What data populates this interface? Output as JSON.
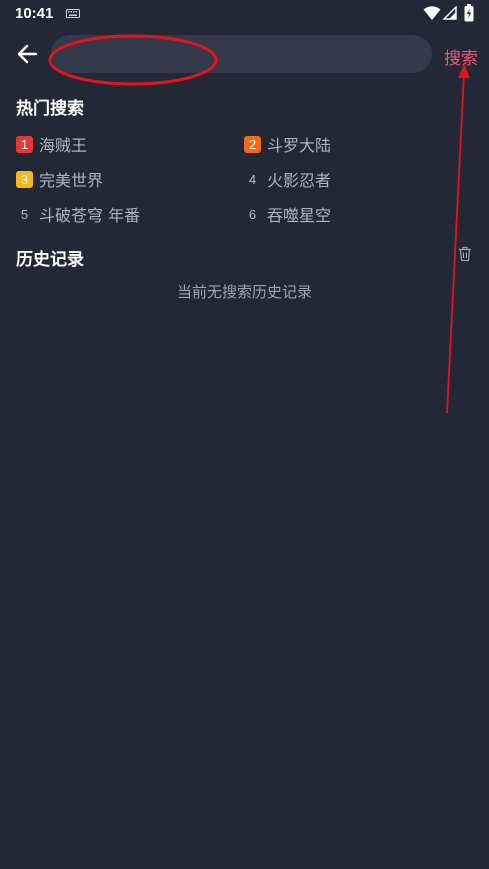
{
  "status_bar": {
    "time": "10:41"
  },
  "search": {
    "value": "",
    "placeholder": "",
    "button_label": "搜索"
  },
  "hot_search": {
    "title": "热门搜索",
    "items": [
      {
        "rank": "1",
        "label": "海贼王",
        "badge_color": "#e53935"
      },
      {
        "rank": "2",
        "label": "斗罗大陆",
        "badge_color": "#f26b1d"
      },
      {
        "rank": "3",
        "label": "完美世界",
        "badge_color": "#f6b817"
      },
      {
        "rank": "4",
        "label": "火影忍者",
        "badge_color": ""
      },
      {
        "rank": "5",
        "label": "斗破苍穹 年番",
        "badge_color": ""
      },
      {
        "rank": "6",
        "label": "吞噬星空",
        "badge_color": ""
      }
    ]
  },
  "history": {
    "title": "历史记录",
    "empty_text": "当前无搜索历史记录"
  },
  "colors": {
    "background": "#232836",
    "search_box": "#343a4a",
    "accent": "#f0566f",
    "annotation": "#e3141c"
  },
  "icons": {
    "back": "arrow-left-icon",
    "trash": "trash-icon",
    "wifi": "wifi-icon",
    "signal": "signal-icon",
    "battery": "battery-charging-icon",
    "keyboard": "keyboard-icon"
  }
}
